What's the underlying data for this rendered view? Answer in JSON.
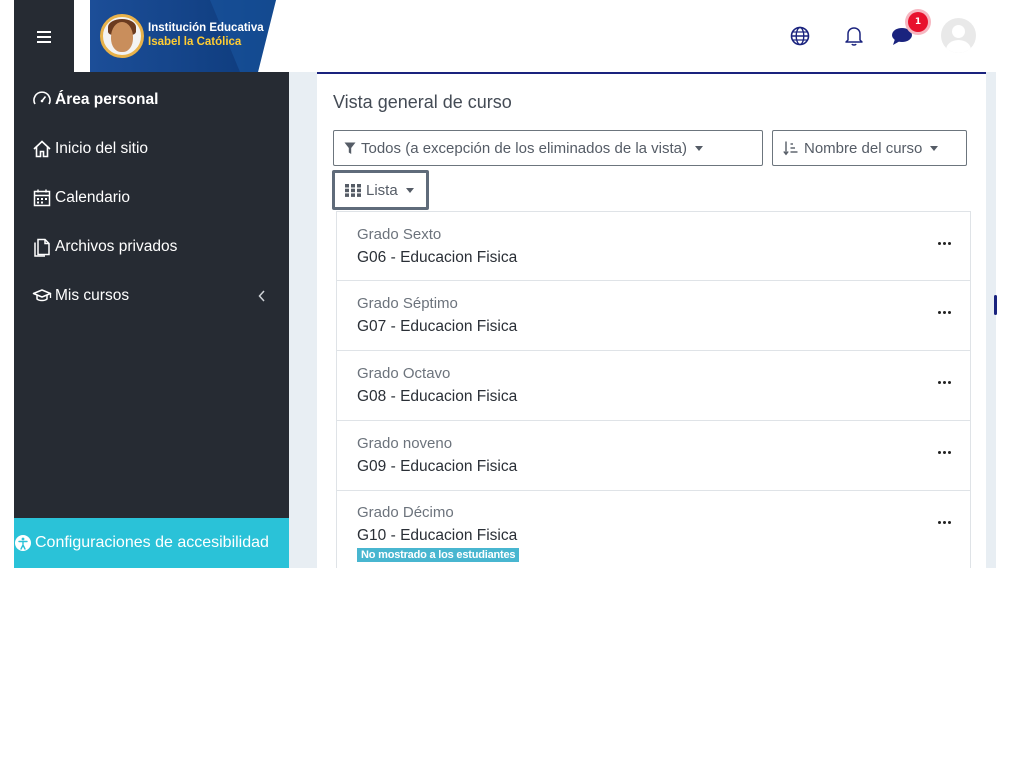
{
  "header": {
    "logo_line1": "Institución Educativa",
    "logo_line2": "Isabel la Católica",
    "message_count": "1",
    "icons": [
      "menu-icon",
      "globe-icon",
      "bell-icon",
      "chat-icon",
      "user-avatar"
    ]
  },
  "sidebar": {
    "items": [
      {
        "label": "Área personal",
        "icon": "dashboard-icon"
      },
      {
        "label": "Inicio del sitio",
        "icon": "home-icon"
      },
      {
        "label": "Calendario",
        "icon": "calendar-icon"
      },
      {
        "label": "Archivos privados",
        "icon": "files-icon"
      },
      {
        "label": "Mis cursos",
        "icon": "graduation-cap-icon"
      }
    ],
    "accessibility_label": "Configuraciones de accesibilidad"
  },
  "main": {
    "title": "Vista general de curso",
    "filter_label": "Todos (a excepción de los eliminados de la vista)",
    "sort_label": "Nombre del curso",
    "view_label": "Lista",
    "courses": [
      {
        "category": "Grado Sexto",
        "name": "G06 - Educacion Fisica",
        "tag": ""
      },
      {
        "category": "Grado Séptimo",
        "name": "G07 - Educacion Fisica",
        "tag": ""
      },
      {
        "category": "Grado Octavo",
        "name": "G08 - Educacion Fisica",
        "tag": ""
      },
      {
        "category": "Grado noveno",
        "name": "G09 - Educacion Fisica",
        "tag": ""
      },
      {
        "category": "Grado Décimo",
        "name": "G10 - Educacion Fisica",
        "tag": "No mostrado a los estudiantes"
      }
    ]
  },
  "colors": {
    "sidebar_bg": "#262b33",
    "accessibility_bg": "#2ac2d8",
    "accent_blue": "#1a237e",
    "badge_red": "#e8112d",
    "tag_bg": "#48b6d0"
  }
}
